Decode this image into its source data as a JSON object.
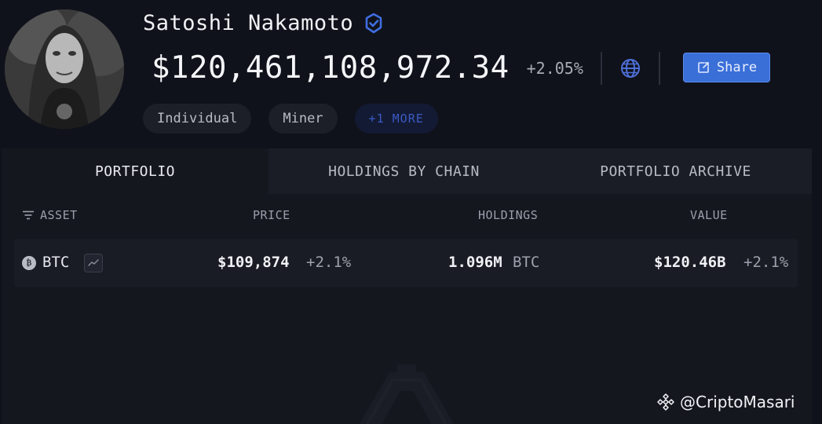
{
  "profile": {
    "name": "Satoshi Nakamoto",
    "verified_icon": "verified-badge-icon",
    "total_value": "$120,461,108,972.34",
    "total_change": "+2.05%",
    "share_label": "Share",
    "tags": [
      "Individual",
      "Miner"
    ],
    "more_tag": "+1 MORE"
  },
  "tabs": [
    {
      "label": "PORTFOLIO",
      "active": true
    },
    {
      "label": "HOLDINGS BY CHAIN",
      "active": false
    },
    {
      "label": "PORTFOLIO ARCHIVE",
      "active": false
    }
  ],
  "table": {
    "headers": {
      "asset": "ASSET",
      "price": "PRICE",
      "holdings": "HOLDINGS",
      "value": "VALUE"
    },
    "rows": [
      {
        "symbol": "BTC",
        "price": "$109,874",
        "price_change": "+2.1%",
        "holdings": "1.096M",
        "holdings_unit": "BTC",
        "value": "$120.46B",
        "value_change": "+2.1%"
      }
    ]
  },
  "credit": {
    "handle": "@CriptoMasari"
  },
  "colors": {
    "accent": "#3a6fd8",
    "background": "#10121b",
    "panel": "#15171f"
  }
}
